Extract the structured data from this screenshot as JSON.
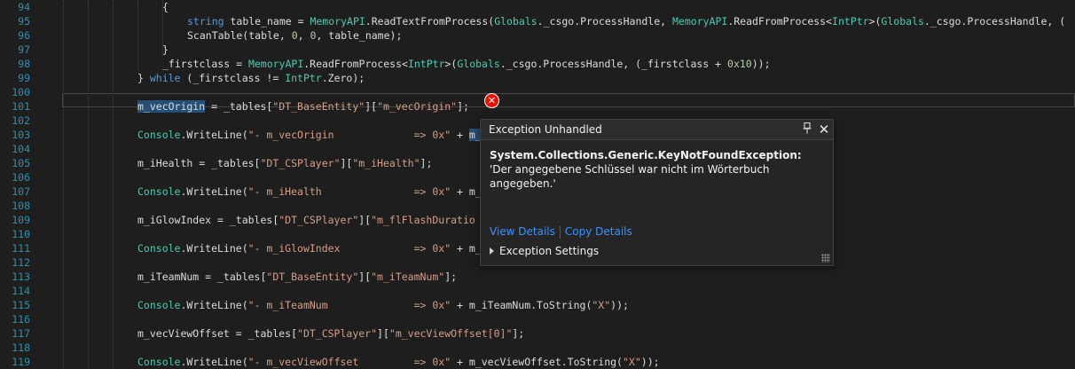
{
  "editor": {
    "lines": [
      {
        "num": "94",
        "indent": 3,
        "tokens": [
          {
            "t": "{",
            "c": ""
          }
        ]
      },
      {
        "num": "95",
        "indent": 4,
        "tokens": [
          {
            "t": "string",
            "c": "kw"
          },
          {
            "t": " table_name = ",
            "c": ""
          },
          {
            "t": "MemoryAPI",
            "c": "cls"
          },
          {
            "t": ".ReadTextFromProcess(",
            "c": ""
          },
          {
            "t": "Globals",
            "c": "cls"
          },
          {
            "t": "._csgo.ProcessHandle, ",
            "c": ""
          },
          {
            "t": "MemoryAPI",
            "c": "cls"
          },
          {
            "t": ".ReadFromProcess<",
            "c": ""
          },
          {
            "t": "IntPtr",
            "c": "cls"
          },
          {
            "t": ">(",
            "c": ""
          },
          {
            "t": "Globals",
            "c": "cls"
          },
          {
            "t": "._csgo.ProcessHandle, (",
            "c": ""
          }
        ]
      },
      {
        "num": "96",
        "indent": 4,
        "tokens": [
          {
            "t": "ScanTable(table, ",
            "c": ""
          },
          {
            "t": "0",
            "c": "num"
          },
          {
            "t": ", ",
            "c": ""
          },
          {
            "t": "0",
            "c": "num"
          },
          {
            "t": ", table_name);",
            "c": ""
          }
        ]
      },
      {
        "num": "97",
        "indent": 3,
        "tokens": [
          {
            "t": "}",
            "c": ""
          }
        ]
      },
      {
        "num": "98",
        "indent": 3,
        "tokens": [
          {
            "t": "_firstclass = ",
            "c": ""
          },
          {
            "t": "MemoryAPI",
            "c": "cls"
          },
          {
            "t": ".ReadFromProcess<",
            "c": ""
          },
          {
            "t": "IntPtr",
            "c": "cls"
          },
          {
            "t": ">(",
            "c": ""
          },
          {
            "t": "Globals",
            "c": "cls"
          },
          {
            "t": "._csgo.ProcessHandle, (_firstclass + ",
            "c": ""
          },
          {
            "t": "0x10",
            "c": "num"
          },
          {
            "t": "));",
            "c": ""
          }
        ]
      },
      {
        "num": "99",
        "indent": 2,
        "tokens": [
          {
            "t": "} ",
            "c": ""
          },
          {
            "t": "while",
            "c": "kw"
          },
          {
            "t": " (_firstclass != ",
            "c": ""
          },
          {
            "t": "IntPtr",
            "c": "cls"
          },
          {
            "t": ".Zero);",
            "c": ""
          }
        ]
      },
      {
        "num": "100",
        "indent": 2,
        "tokens": []
      },
      {
        "num": "101",
        "indent": 2,
        "tokens": [
          {
            "t": "m_vecOrigin",
            "c": "sel"
          },
          {
            "t": " = _tables[",
            "c": ""
          },
          {
            "t": "\"DT_BaseEntity\"",
            "c": "str"
          },
          {
            "t": "][",
            "c": ""
          },
          {
            "t": "\"m_vecOrigin\"",
            "c": "str"
          },
          {
            "t": "];",
            "c": ""
          }
        ]
      },
      {
        "num": "102",
        "indent": 2,
        "tokens": []
      },
      {
        "num": "103",
        "indent": 2,
        "tokens": [
          {
            "t": "Console",
            "c": "cls"
          },
          {
            "t": ".WriteLine(",
            "c": ""
          },
          {
            "t": "\"- m_vecOrigin             => 0x\"",
            "c": "str"
          },
          {
            "t": " + ",
            "c": ""
          },
          {
            "t": "m_",
            "c": "sel"
          }
        ]
      },
      {
        "num": "104",
        "indent": 2,
        "tokens": []
      },
      {
        "num": "105",
        "indent": 2,
        "tokens": [
          {
            "t": "m_iHealth = _tables[",
            "c": ""
          },
          {
            "t": "\"DT_CSPlayer\"",
            "c": "str"
          },
          {
            "t": "][",
            "c": ""
          },
          {
            "t": "\"m_iHealth\"",
            "c": "str"
          },
          {
            "t": "];",
            "c": ""
          }
        ]
      },
      {
        "num": "106",
        "indent": 2,
        "tokens": []
      },
      {
        "num": "107",
        "indent": 2,
        "tokens": [
          {
            "t": "Console",
            "c": "cls"
          },
          {
            "t": ".WriteLine(",
            "c": ""
          },
          {
            "t": "\"- m_iHealth               => 0x\"",
            "c": "str"
          },
          {
            "t": " + m_",
            "c": ""
          }
        ]
      },
      {
        "num": "108",
        "indent": 2,
        "tokens": []
      },
      {
        "num": "109",
        "indent": 2,
        "tokens": [
          {
            "t": "m_iGlowIndex = _tables[",
            "c": ""
          },
          {
            "t": "\"DT_CSPlayer\"",
            "c": "str"
          },
          {
            "t": "][",
            "c": ""
          },
          {
            "t": "\"m_flFlashDuratio",
            "c": "str"
          }
        ]
      },
      {
        "num": "110",
        "indent": 2,
        "tokens": []
      },
      {
        "num": "111",
        "indent": 2,
        "tokens": [
          {
            "t": "Console",
            "c": "cls"
          },
          {
            "t": ".WriteLine(",
            "c": ""
          },
          {
            "t": "\"- m_iGlowIndex            => 0x\"",
            "c": "str"
          },
          {
            "t": " + m_",
            "c": ""
          }
        ]
      },
      {
        "num": "112",
        "indent": 2,
        "tokens": []
      },
      {
        "num": "113",
        "indent": 2,
        "tokens": [
          {
            "t": "m_iTeamNum = _tables[",
            "c": ""
          },
          {
            "t": "\"DT_BaseEntity\"",
            "c": "str"
          },
          {
            "t": "][",
            "c": ""
          },
          {
            "t": "\"m_iTeamNum\"",
            "c": "str"
          },
          {
            "t": "];",
            "c": ""
          }
        ]
      },
      {
        "num": "114",
        "indent": 2,
        "tokens": []
      },
      {
        "num": "115",
        "indent": 2,
        "tokens": [
          {
            "t": "Console",
            "c": "cls"
          },
          {
            "t": ".WriteLine(",
            "c": ""
          },
          {
            "t": "\"- m_iTeamNum              => 0x\"",
            "c": "str"
          },
          {
            "t": " + m_iTeamNum.ToString(",
            "c": ""
          },
          {
            "t": "\"X\"",
            "c": "str"
          },
          {
            "t": "));",
            "c": ""
          }
        ]
      },
      {
        "num": "116",
        "indent": 2,
        "tokens": []
      },
      {
        "num": "117",
        "indent": 2,
        "tokens": [
          {
            "t": "m_vecViewOffset = _tables[",
            "c": ""
          },
          {
            "t": "\"DT_CSPlayer\"",
            "c": "str"
          },
          {
            "t": "][",
            "c": ""
          },
          {
            "t": "\"m_vecViewOffset[0]\"",
            "c": "str"
          },
          {
            "t": "];",
            "c": ""
          }
        ]
      },
      {
        "num": "118",
        "indent": 2,
        "tokens": []
      },
      {
        "num": "119",
        "indent": 2,
        "tokens": [
          {
            "t": "Console",
            "c": "cls"
          },
          {
            "t": ".WriteLine(",
            "c": ""
          },
          {
            "t": "\"- m_vecViewOffset         => 0x\"",
            "c": "str"
          },
          {
            "t": " + m_vecViewOffset.ToString(",
            "c": ""
          },
          {
            "t": "\"X\"",
            "c": "str"
          },
          {
            "t": "));",
            "c": ""
          }
        ]
      }
    ],
    "error_glyph": "✕"
  },
  "exception_popup": {
    "title": "Exception Unhandled",
    "pin_glyph": "📌",
    "close_glyph": "✕",
    "exception_type": "System.Collections.Generic.KeyNotFoundException:",
    "message": " 'Der angegebene Schlüssel war nicht im Wörterbuch angegeben.'",
    "view_details": "View Details",
    "copy_details": "Copy Details",
    "settings_label": "Exception Settings"
  },
  "colors": {
    "background": "#1e1e1e",
    "line_number": "#2b91af",
    "keyword": "#569cd6",
    "type": "#4ec9b0",
    "string": "#d69d85",
    "number": "#b5cea8",
    "selection": "#264f78",
    "error": "#e51400",
    "link": "#3794ff"
  }
}
